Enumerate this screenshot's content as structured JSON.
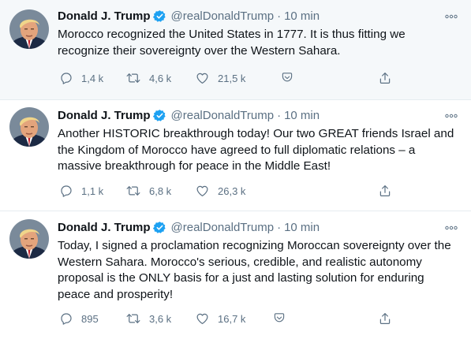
{
  "tweets": [
    {
      "name": "Donald J. Trump",
      "handle": "@realDonaldTrump",
      "separator": "·",
      "time": "10 min",
      "text": "Morocco recognized the United States in 1777.  It is thus fitting we\nrecognize their sovereignty over the Western Sahara.",
      "replies": "1,4 k",
      "retweets": "4,6 k",
      "likes": "21,5 k"
    },
    {
      "name": "Donald J. Trump",
      "handle": "@realDonaldTrump",
      "separator": "·",
      "time": "10 min",
      "text": "Another HISTORIC breakthrough today! Our two GREAT friends Israel and\nthe Kingdom of Morocco have agreed to full diplomatic relations – a\nmassive breakthrough for peace in the Middle East!",
      "replies": "1,1 k",
      "retweets": "6,8 k",
      "likes": "26,3 k"
    },
    {
      "name": "Donald J. Trump",
      "handle": "@realDonaldTrump",
      "separator": "·",
      "time": "10 min",
      "text": "Today, I signed a proclamation recognizing Moroccan sovereignty over the\nWestern Sahara.  Morocco's serious, credible, and realistic autonomy\nproposal is the ONLY basis for a just and lasting solution for enduring\npeace and prosperity!",
      "replies": "895",
      "retweets": "3,6 k",
      "likes": "16,7 k"
    }
  ],
  "icons": {
    "verified": "verified-badge-icon",
    "more": "more-options-icon",
    "reply": "reply-icon",
    "retweet": "retweet-icon",
    "like": "heart-icon",
    "bookmark": "bookmark-icon",
    "share": "share-icon"
  },
  "colors": {
    "verified": "#1da1f2",
    "secondary_text": "#5b7083",
    "primary_text": "#0f1419",
    "highlight_bg": "#f5f8fa",
    "divider": "#e6ecf0"
  }
}
